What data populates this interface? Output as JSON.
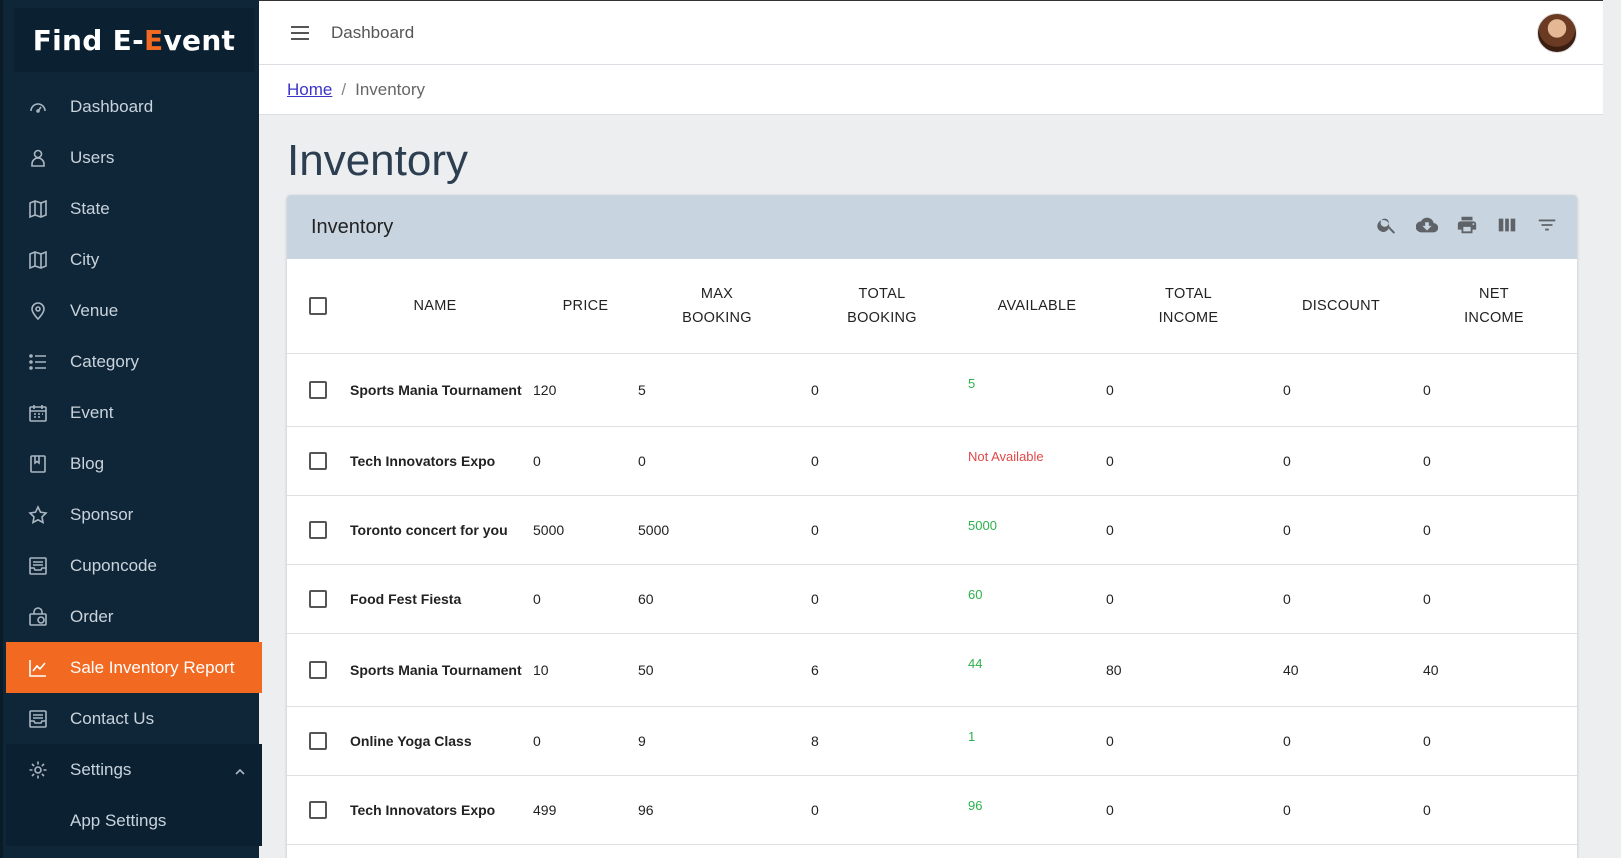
{
  "brand": {
    "part1": "Find E-",
    "part2": "E",
    "part3": "vent"
  },
  "sidebar": {
    "items": [
      {
        "label": "Dashboard",
        "icon": "gauge-icon"
      },
      {
        "label": "Users",
        "icon": "user-icon"
      },
      {
        "label": "State",
        "icon": "map-icon"
      },
      {
        "label": "City",
        "icon": "map-icon"
      },
      {
        "label": "Venue",
        "icon": "location-pin-icon"
      },
      {
        "label": "Category",
        "icon": "list-icon"
      },
      {
        "label": "Event",
        "icon": "calendar-icon"
      },
      {
        "label": "Blog",
        "icon": "book-icon"
      },
      {
        "label": "Sponsor",
        "icon": "star-icon"
      },
      {
        "label": "Cuponcode",
        "icon": "inbox-icon"
      },
      {
        "label": "Order",
        "icon": "bag-icon"
      },
      {
        "label": "Sale Inventory Report",
        "icon": "chart-line-icon"
      },
      {
        "label": "Contact Us",
        "icon": "inbox-icon"
      },
      {
        "label": "Settings",
        "icon": "gear-icon"
      }
    ],
    "sub_items": [
      {
        "label": "App Settings"
      }
    ],
    "active": "Sale Inventory Report"
  },
  "topbar": {
    "title": "Dashboard"
  },
  "breadcrumb": {
    "home": "Home",
    "current": "Inventory"
  },
  "page": {
    "title": "Inventory"
  },
  "card": {
    "title": "Inventory",
    "tools": [
      "search-icon",
      "cloud-download-icon",
      "print-icon",
      "columns-icon",
      "filter-icon"
    ]
  },
  "table": {
    "headers": {
      "name": "NAME",
      "price": "PRICE",
      "max_booking_1": "MAX",
      "max_booking_2": "BOOKING",
      "total_booking_1": "TOTAL",
      "total_booking_2": "BOOKING",
      "available": "AVAILABLE",
      "total_income_1": "TOTAL",
      "total_income_2": "INCOME",
      "discount": "DISCOUNT",
      "net_income_1": "NET",
      "net_income_2": "INCOME"
    },
    "rows": [
      {
        "name": "Sports Mania Tournament",
        "price": "120",
        "max_booking": "5",
        "total_booking": "0",
        "available": "5",
        "available_status": "green",
        "total_income": "0",
        "discount": "0",
        "net_income": "0"
      },
      {
        "name": "Tech Innovators Expo",
        "price": "0",
        "max_booking": "0",
        "total_booking": "0",
        "available": "Not Available",
        "available_status": "red",
        "total_income": "0",
        "discount": "0",
        "net_income": "0"
      },
      {
        "name": "Toronto concert for you",
        "price": "5000",
        "max_booking": "5000",
        "total_booking": "0",
        "available": "5000",
        "available_status": "green",
        "total_income": "0",
        "discount": "0",
        "net_income": "0"
      },
      {
        "name": "Food Fest Fiesta",
        "price": "0",
        "max_booking": "60",
        "total_booking": "0",
        "available": "60",
        "available_status": "green",
        "total_income": "0",
        "discount": "0",
        "net_income": "0"
      },
      {
        "name": "Sports Mania Tournament",
        "price": "10",
        "max_booking": "50",
        "total_booking": "6",
        "available": "44",
        "available_status": "green",
        "total_income": "80",
        "discount": "40",
        "net_income": "40"
      },
      {
        "name": "Online Yoga Class",
        "price": "0",
        "max_booking": "9",
        "total_booking": "8",
        "available": "1",
        "available_status": "green",
        "total_income": "0",
        "discount": "0",
        "net_income": "0"
      },
      {
        "name": "Tech Innovators Expo",
        "price": "499",
        "max_booking": "96",
        "total_booking": "0",
        "available": "96",
        "available_status": "green",
        "total_income": "0",
        "discount": "0",
        "net_income": "0"
      }
    ]
  },
  "colors": {
    "accent": "#f26a21",
    "sidebar_bg": "#0f2638",
    "card_header": "#c8d5e0",
    "available_green": "#2bb24c",
    "unavailable_red": "#e04848"
  }
}
